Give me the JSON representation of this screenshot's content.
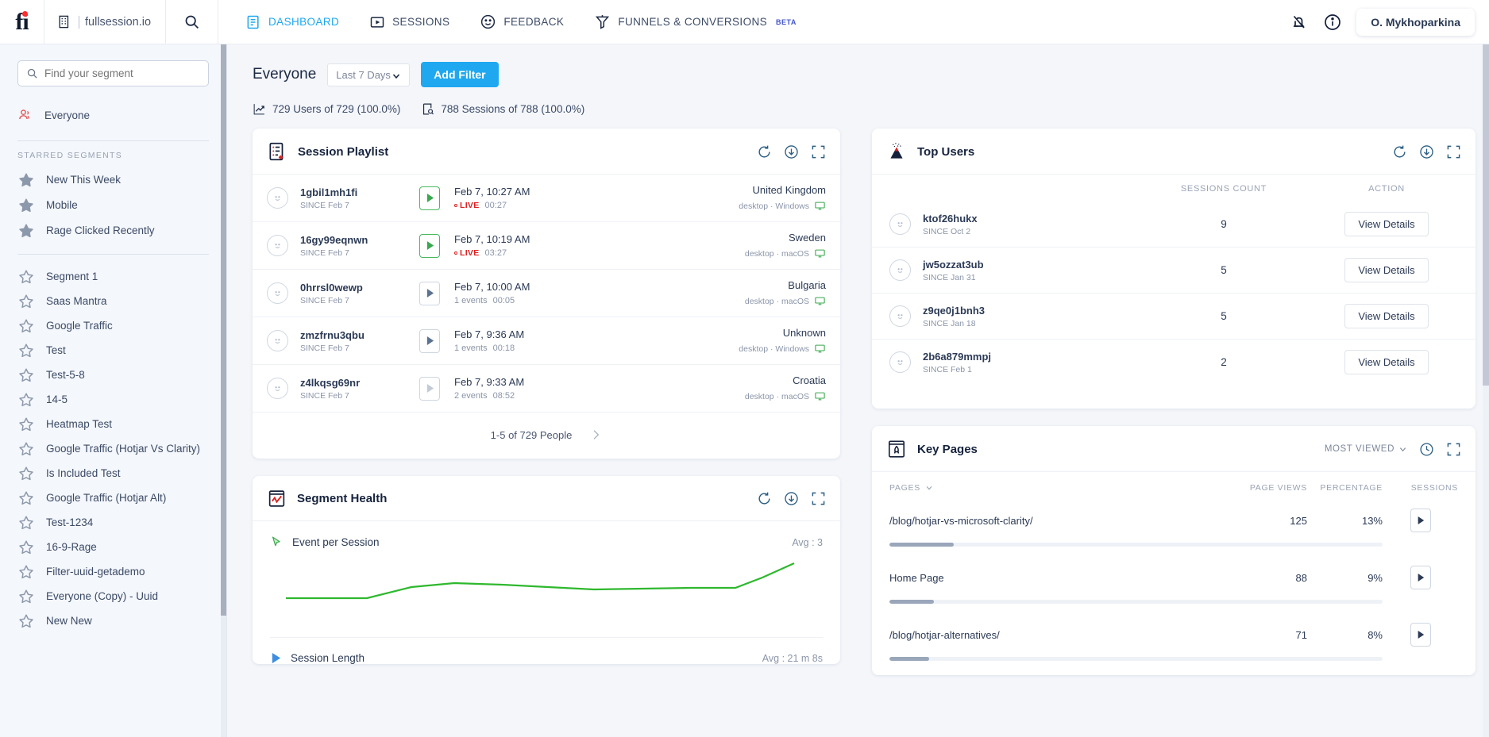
{
  "topnav": {
    "site": "fullsession.io",
    "items": [
      {
        "label": "DASHBOARD",
        "icon": "dashboard-icon",
        "active": true
      },
      {
        "label": "SESSIONS",
        "icon": "sessions-play-icon",
        "active": false
      },
      {
        "label": "FEEDBACK",
        "icon": "smiley-icon",
        "active": false
      },
      {
        "label": "FUNNELS & CONVERSIONS",
        "icon": "funnel-icon",
        "active": false,
        "badge": "BETA"
      }
    ],
    "user": "O. Mykhoparkina",
    "accent": "#1fa8f0"
  },
  "sidebar": {
    "search_placeholder": "Find your segment",
    "everyone": "Everyone",
    "starred_header": "STARRED SEGMENTS",
    "starred": [
      "New This Week",
      "Mobile",
      "Rage Clicked Recently"
    ],
    "segments": [
      "Segment 1",
      "Saas Mantra",
      "Google Traffic",
      "Test",
      "Test-5-8",
      "14-5",
      "Heatmap Test",
      "Google Traffic (Hotjar Vs Clarity)",
      "Is Included Test",
      "Google Traffic (Hotjar Alt)",
      "Test-1234",
      "16-9-Rage",
      "Filter-uuid-getademo",
      "Everyone (Copy) - Uuid",
      "New New"
    ]
  },
  "filterbar": {
    "segment_title": "Everyone",
    "date_range": "Last 7 Days",
    "add_filter": "Add Filter",
    "stat_users": "729 Users of 729 (100.0%)",
    "stat_sessions": "788 Sessions of 788 (100.0%)"
  },
  "session_playlist": {
    "title": "Session Playlist",
    "pager": "1-5 of 729 People",
    "rows": [
      {
        "user": "1gbil1mh1fi",
        "since": "SINCE Feb 7",
        "date": "Feb 7, 10:27 AM",
        "live": true,
        "live_label": "LIVE",
        "duration": "00:27",
        "events": "",
        "country": "United Kingdom",
        "device": "desktop · Windows"
      },
      {
        "user": "16gy99eqnwn",
        "since": "SINCE Feb 7",
        "date": "Feb 7, 10:19 AM",
        "live": true,
        "live_label": "LIVE",
        "duration": "03:27",
        "events": "",
        "country": "Sweden",
        "device": "desktop · macOS"
      },
      {
        "user": "0hrrsl0wewp",
        "since": "SINCE Feb 7",
        "date": "Feb 7, 10:00 AM",
        "live": false,
        "live_label": "",
        "duration": "00:05",
        "events": "1 events",
        "country": "Bulgaria",
        "device": "desktop · macOS"
      },
      {
        "user": "zmzfrnu3qbu",
        "since": "SINCE Feb 7",
        "date": "Feb 7, 9:36 AM",
        "live": false,
        "live_label": "",
        "duration": "00:18",
        "events": "1 events",
        "country": "Unknown",
        "device": "desktop · Windows"
      },
      {
        "user": "z4lkqsg69nr",
        "since": "SINCE Feb 7",
        "date": "Feb 7, 9:33 AM",
        "live": false,
        "live_label": "",
        "duration": "08:52",
        "events": "2 events",
        "country": "Croatia",
        "device": "desktop · macOS"
      }
    ]
  },
  "top_users": {
    "title": "Top Users",
    "col_sessions": "SESSIONS COUNT",
    "col_action": "ACTION",
    "action_label": "View Details",
    "rows": [
      {
        "user": "ktof26hukx",
        "since": "SINCE Oct 2",
        "count": "9"
      },
      {
        "user": "jw5ozzat3ub",
        "since": "SINCE Jan 31",
        "count": "5"
      },
      {
        "user": "z9qe0j1bnh3",
        "since": "SINCE Jan 18",
        "count": "5"
      },
      {
        "user": "2b6a879mmpj",
        "since": "SINCE Feb 1",
        "count": "2"
      }
    ]
  },
  "key_pages": {
    "title": "Key Pages",
    "sort_label": "MOST VIEWED",
    "col_pages": "PAGES",
    "col_views": "PAGE VIEWS",
    "col_percentage": "PERCENTAGE",
    "col_sessions": "SESSIONS",
    "rows": [
      {
        "page": "/blog/hotjar-vs-microsoft-clarity/",
        "views": "125",
        "percentage": "13%",
        "bar": 13
      },
      {
        "page": "Home Page",
        "views": "88",
        "percentage": "9%",
        "bar": 9
      },
      {
        "page": "/blog/hotjar-alternatives/",
        "views": "71",
        "percentage": "8%",
        "bar": 8
      }
    ]
  },
  "segment_health": {
    "title": "Segment Health",
    "metrics": [
      {
        "name": "Event per Session",
        "avg": "Avg : 3",
        "icon": "cursor-icon"
      },
      {
        "name": "Session Length",
        "avg": "Avg : 21 m 8s",
        "icon": "play-triangle-icon"
      }
    ]
  },
  "chart_data": {
    "type": "line",
    "title": "Event per Session",
    "ylabel": "",
    "xlabel": "",
    "series": [
      {
        "name": "Event per Session",
        "color": "#2eb82e",
        "values": [
          2.6,
          2.6,
          3.0,
          3.2,
          3.1,
          3.0,
          2.9,
          2.95,
          3.0,
          3.05,
          4.2
        ]
      }
    ],
    "x": [
      0,
      1,
      2,
      3,
      4,
      5,
      6,
      7,
      8,
      9,
      10
    ],
    "ylim": [
      0,
      5
    ],
    "grid": false,
    "legend": "none"
  }
}
